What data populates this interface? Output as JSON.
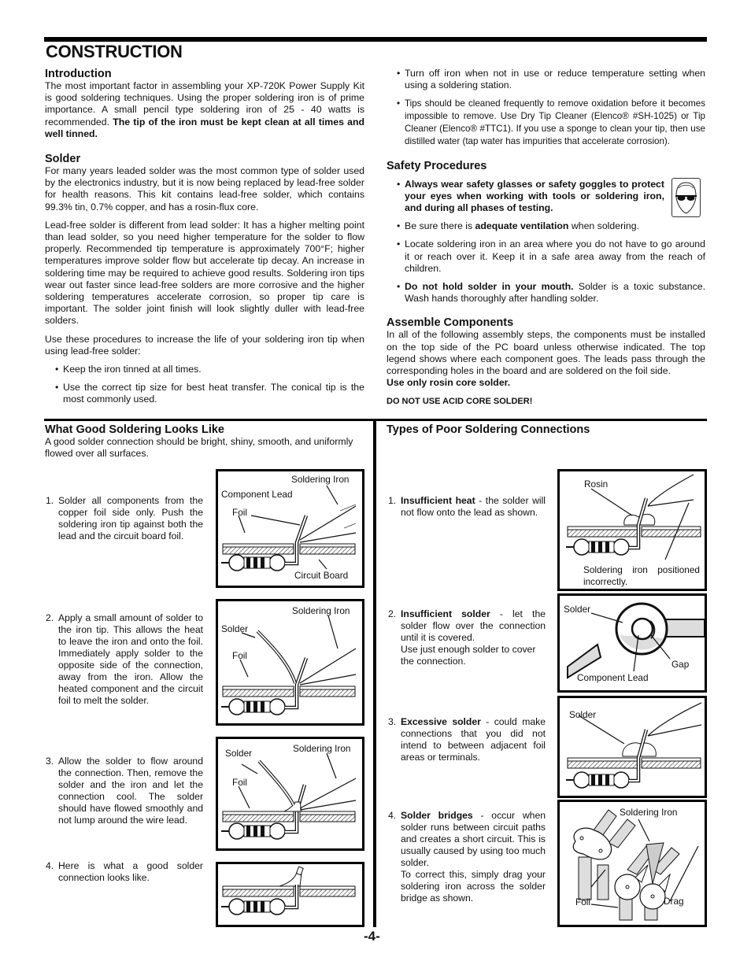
{
  "page": {
    "title": "CONSTRUCTION",
    "page_number": "-4-"
  },
  "intro": {
    "heading": "Introduction",
    "text": "The most important factor in assembling your XP-720K Power Supply Kit is good soldering techniques. Using the proper soldering iron is of prime importance. A small pencil type soldering iron of 25 - 40 watts is recommended. ",
    "bold": "The tip of the iron must be kept clean at all times and well tinned."
  },
  "solder": {
    "heading": "Solder",
    "para1": "For many years leaded solder was the most common type of solder used by the electronics industry, but it is now being replaced by lead-free solder for health reasons. This kit contains lead-free solder, which contains 99.3% tin, 0.7% copper, and has a rosin-flux core.",
    "para2": "Lead-free solder is different from lead solder: It has a higher melting point than lead solder, so you need higher temperature for the solder to flow properly. Recommended tip temperature is approximately 700°F; higher temperatures improve solder flow but accelerate tip decay. An increase in soldering time may be required to achieve good results. Soldering iron tips wear out faster since lead-free solders are more corrosive and the higher soldering temperatures accelerate corrosion, so proper tip care is important. The solder joint finish will look slightly duller with lead-free solders.",
    "para3": "Use these procedures to increase the life of your soldering iron tip when using lead-free solder:",
    "bullets": [
      "Keep the iron tinned at all times.",
      "Use the correct tip size for best heat transfer. The conical tip is the most commonly used.",
      "Turn off iron when not in use or reduce temperature setting when using a soldering station.",
      "Tips should be cleaned frequently to remove oxidation before it becomes impossible to remove. Use Dry Tip Cleaner (Elenco® #SH-1025) or Tip Cleaner (Elenco® #TTC1). If you use a sponge to clean your tip, then use distilled water (tap water has impurities that accelerate corrosion)."
    ]
  },
  "safety": {
    "heading": "Safety Procedures",
    "icon": "safety-goggles-icon",
    "items": [
      {
        "bold": "Always wear safety glasses or safety goggles to protect your eyes when working with tools or soldering iron, and during all phases of testing.",
        "pre": "",
        "post": ""
      },
      {
        "pre": "Be sure there is ",
        "bold": "adequate ventilation",
        "post": " when soldering."
      },
      {
        "pre": "Locate soldering iron in an area where you do not have to go around it or reach over it. Keep it in a safe area away from the reach of children.",
        "bold": "",
        "post": ""
      },
      {
        "pre": "",
        "bold": "Do not hold solder in your mouth.",
        "post": " Solder is a toxic substance. Wash hands thoroughly after handling solder."
      }
    ]
  },
  "assemble": {
    "heading": "Assemble Components",
    "text": "In all of the following assembly steps, the components must be installed on the top side of the PC board unless otherwise indicated. The top legend shows where each component goes. The leads pass through the corresponding holes in the board and are soldered on the foil side.",
    "bold": "Use only rosin core solder.",
    "warning": "DO NOT USE ACID CORE SOLDER!"
  },
  "good": {
    "heading": "What Good Soldering Looks Like",
    "intro": "A good solder connection should be bright, shiny, smooth, and uniformly flowed over all surfaces.",
    "steps": [
      {
        "num": "1.",
        "text": "Solder all components from the copper foil side only.  Push the soldering iron tip against both the lead and the circuit board foil.",
        "labels": {
          "iron": "Soldering Iron",
          "lead": "Component Lead",
          "foil": "Foil",
          "board": "Circuit Board"
        }
      },
      {
        "num": "2.",
        "text": "Apply a small amount of solder to the iron tip. This allows the heat to leave the iron and onto the foil. Immediately apply solder to the opposite side of the connection, away from the iron. Allow the heated component and the circuit foil to melt the solder.",
        "labels": {
          "iron": "Soldering Iron",
          "solder": "Solder",
          "foil": "Foil"
        }
      },
      {
        "num": "3.",
        "text": "Allow the solder to flow around the connection.  Then, remove the solder and the iron and let the connection cool. The solder should have flowed smoothly and not lump around the wire lead.",
        "labels": {
          "iron": "Soldering Iron",
          "solder": "Solder",
          "foil": "Foil"
        }
      },
      {
        "num": "4.",
        "text": "Here is what a good solder connection looks like."
      }
    ]
  },
  "poor": {
    "heading": "Types of Poor Soldering Connections",
    "steps": [
      {
        "num": "1.",
        "bold": "Insufficient heat",
        "text": " - the solder will not flow onto the lead as shown.",
        "labels": {
          "rosin": "Rosin",
          "note": "Soldering iron positioned incorrectly."
        }
      },
      {
        "num": "2.",
        "bold": "Insufficient solder",
        "text": " - let the solder flow over the connection until it is covered.",
        "text2": "Use just enough solder to cover the connection.",
        "labels": {
          "solder": "Solder",
          "gap": "Gap",
          "lead": "Component Lead"
        }
      },
      {
        "num": "3.",
        "bold": "Excessive solder",
        "text": " - could make connections that you did not intend to between adjacent foil areas or terminals.",
        "labels": {
          "solder": "Solder"
        }
      },
      {
        "num": "4.",
        "bold": "Solder bridges",
        "text": " - occur when solder runs between circuit paths and creates a short circuit. This is usually caused by using too much solder.",
        "text2": "To correct this, simply drag your soldering iron across the solder bridge as shown.",
        "labels": {
          "iron": "Soldering Iron",
          "foil": "Foil",
          "drag": "Drag"
        }
      }
    ]
  }
}
